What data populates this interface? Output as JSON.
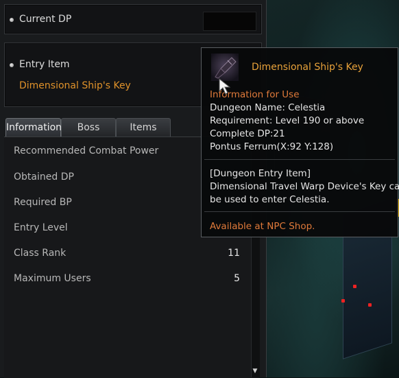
{
  "current_dp": {
    "label": "Current DP"
  },
  "entry_item": {
    "label": "Entry Item",
    "name": "Dimensional Ship's Key"
  },
  "tabs": [
    {
      "label": "Information",
      "active": true
    },
    {
      "label": "Boss",
      "active": false
    },
    {
      "label": "Items",
      "active": false
    }
  ],
  "info_rows": [
    {
      "label": "Recommended Combat Power",
      "value": ""
    },
    {
      "label": "Obtained DP",
      "value": ""
    },
    {
      "label": "Required BP",
      "value": ""
    },
    {
      "label": "Entry Level",
      "value": ""
    },
    {
      "label": "Class Rank",
      "value": "11"
    },
    {
      "label": "Maximum Users",
      "value": "5"
    }
  ],
  "tooltip": {
    "title": "Dimensional Ship's Key",
    "section_heading": "Information for Use",
    "lines": [
      "Dungeon Name: Celestia",
      "Requirement: Level 190 or above",
      "Complete DP:21",
      "Pontus Ferrum(X:92 Y:128)"
    ],
    "item_type": "[Dungeon Entry Item]",
    "description_lines": [
      "Dimensional Travel Warp Device's Key can",
      "be used to enter Celestia."
    ],
    "shop_note": "Available at NPC Shop."
  },
  "colors": {
    "accent_orange": "#e0922a",
    "tooltip_title": "#e8a23a",
    "tooltip_subhead": "#e07a3a"
  }
}
